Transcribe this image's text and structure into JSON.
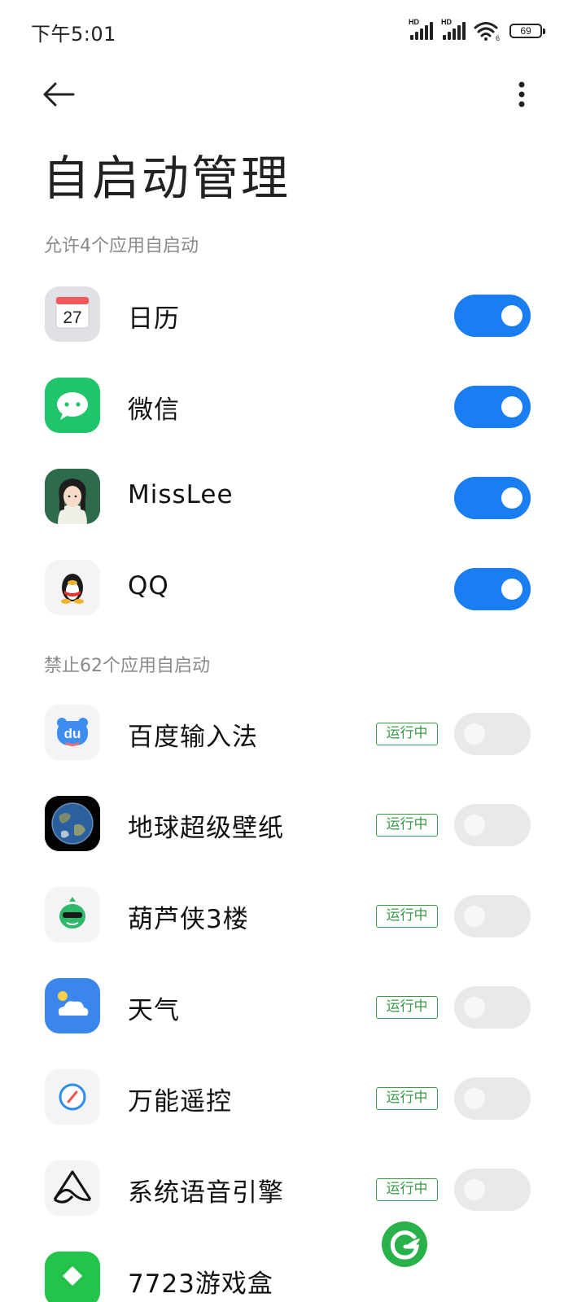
{
  "status_bar": {
    "time": "下午5:01",
    "hd_label": "HD",
    "wifi_sub": "6",
    "battery": "69"
  },
  "header": {
    "title": "自启动管理",
    "icons": {
      "back": "back-arrow-icon",
      "more": "more-vertical-icon"
    }
  },
  "sections": {
    "allowed": "允许4个应用自启动",
    "blocked": "禁止62个应用自启动"
  },
  "allowed_apps": [
    {
      "name": "日历",
      "icon": "calendar-icon",
      "calendar_day": "27",
      "enabled": true
    },
    {
      "name": "微信",
      "icon": "wechat-icon",
      "enabled": true
    },
    {
      "name": "MissLee",
      "icon": "misslee-icon",
      "enabled": true
    },
    {
      "name": "QQ",
      "icon": "qq-icon",
      "enabled": true
    }
  ],
  "blocked_apps": [
    {
      "name": "百度输入法",
      "icon": "baidu-input-icon",
      "icon_text": "du",
      "status": "运行中",
      "enabled": false
    },
    {
      "name": "地球超级壁纸",
      "icon": "earth-wallpaper-icon",
      "status": "运行中",
      "enabled": false
    },
    {
      "name": "葫芦侠3楼",
      "icon": "huluxia-icon",
      "status": "运行中",
      "enabled": false
    },
    {
      "name": "天气",
      "icon": "weather-icon",
      "status": "运行中",
      "enabled": false
    },
    {
      "name": "万能遥控",
      "icon": "remote-control-icon",
      "status": "运行中",
      "enabled": false
    },
    {
      "name": "系统语音引擎",
      "icon": "voice-engine-icon",
      "status": "运行中",
      "enabled": false
    },
    {
      "name": "7723游戏盒",
      "icon": "game-box-icon",
      "status": "",
      "enabled": false
    }
  ],
  "colors": {
    "accent": "#1a7ef3",
    "toggle_off": "#e9e9e9",
    "running_badge": "#3a9a4a",
    "section_text": "#8a8a8a"
  }
}
